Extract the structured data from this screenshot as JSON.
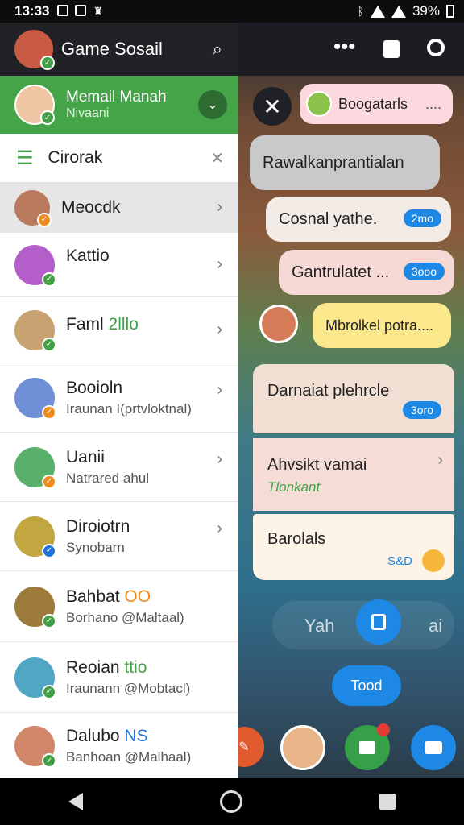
{
  "status": {
    "time": "13:33",
    "battery": "39%"
  },
  "header": {
    "title": "Game Sosail"
  },
  "profile": {
    "name": "Memail Manah",
    "subtitle": "Nivaani"
  },
  "filter": {
    "label": "Cirorak"
  },
  "contacts": [
    {
      "name": "Meocdk",
      "name_accent": "",
      "sub": ""
    },
    {
      "name": "Kattio",
      "name_accent": "",
      "sub": ""
    },
    {
      "name": "Faml",
      "name_accent": "2lllo",
      "sub": ""
    },
    {
      "name": "Booioln",
      "name_accent": "",
      "sub": "Iraunan I(prtvloktnal)"
    },
    {
      "name": "Uanii",
      "name_accent": "",
      "sub": "Natrared ahul"
    },
    {
      "name": "Diroiotrn",
      "name_accent": "",
      "sub": "Synobarn"
    },
    {
      "name": "Bahbat",
      "name_accent": "OO",
      "sub": "Borhano @Maltaal)"
    },
    {
      "name": "Reoian",
      "name_accent": "ttio",
      "sub": "Iraunann @Mobtacl)"
    },
    {
      "name": "Dalubo",
      "name_accent": "NS",
      "sub": "Banhoan @Malhaal)"
    }
  ],
  "game": {
    "chip_label": "Boogatarls",
    "chip_more": "....",
    "bubbles": [
      {
        "text": "Rawalkanprantialan",
        "badge": ""
      },
      {
        "text": "Cosnal yathe.",
        "badge": "2mo"
      },
      {
        "text": "Gantrulatet ...",
        "badge": "3ooo"
      },
      {
        "text": "Mbrolkel potra....",
        "badge": ""
      }
    ],
    "cards": [
      {
        "title": "Darnaiat plehrcle",
        "sub": "",
        "badge": "3oro"
      },
      {
        "title": "Ahvsikt vamai",
        "sub": "Tlonkant",
        "badge": ""
      },
      {
        "title": "Barolals",
        "sub": "",
        "badge": "S&D"
      }
    ],
    "bottom_text_left": "Yah",
    "bottom_text_right": "ai",
    "today_button": "Tood"
  },
  "colors": {
    "accent_green": "#45a448",
    "badge_blue": "#1e88e5",
    "verified_green": "#43a047",
    "verified_orange": "#ef8a1c",
    "verified_blue": "#1e73d8"
  }
}
